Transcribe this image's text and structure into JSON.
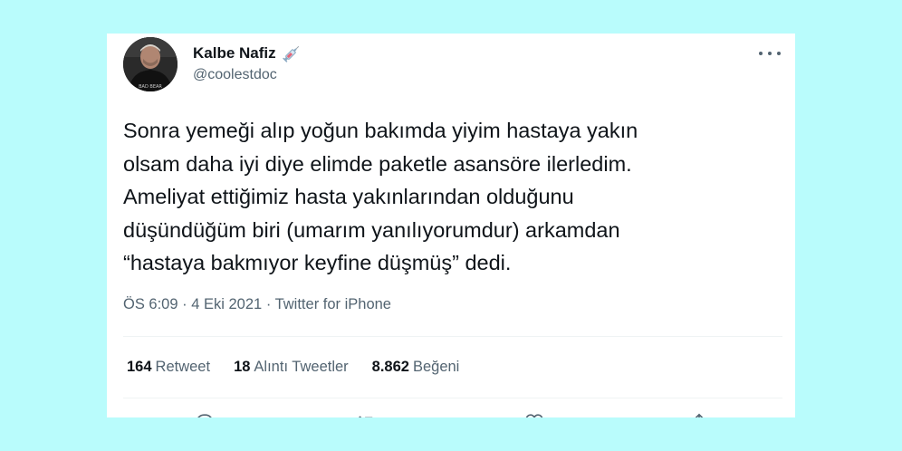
{
  "author": {
    "name": "Kalbe Nafiz",
    "handle": "@coolestdoc",
    "name_emoji": "syringe-icon"
  },
  "tweet": {
    "lines": [
      "Sonra yemeği alıp yoğun bakımda yiyim hastaya yakın",
      "olsam daha iyi diye elimde paketle asansöre ilerledim.",
      "Ameliyat ettiğimiz hasta yakınlarından olduğunu",
      "düşündüğüm biri (umarım yanılıyorumdur) arkamdan",
      "“hastaya bakmıyor keyfine düşmüş” dedi."
    ]
  },
  "meta": {
    "time": "ÖS 6:09",
    "separator": "·",
    "date": "4 Eki 2021",
    "source": "Twitter for iPhone"
  },
  "stats": {
    "retweets_count": "164",
    "retweets_label": "Retweet",
    "quotes_count": "18",
    "quotes_label": "Alıntı Tweetler",
    "likes_count": "8.862",
    "likes_label": "Beğeni"
  },
  "colors": {
    "background": "#b9fcfc",
    "card": "#ffffff",
    "text_primary": "#0f1419",
    "text_secondary": "#536471",
    "divider": "#eff3f4"
  },
  "icons": {
    "more": "more-dots-icon",
    "reply": "reply-icon",
    "retweet": "retweet-icon",
    "like": "like-icon",
    "share": "share-icon"
  }
}
